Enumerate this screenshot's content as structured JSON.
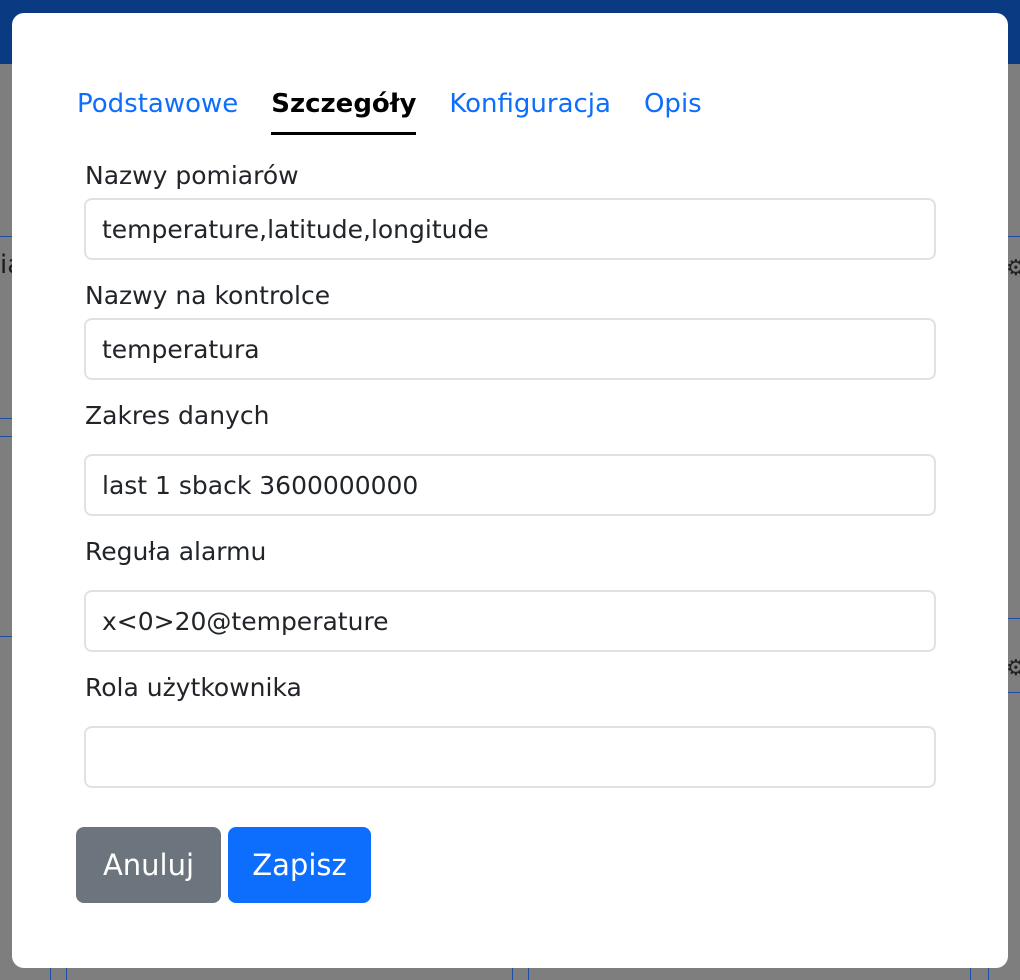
{
  "background": {
    "partial_text": "ia",
    "gear_icon": "gear-icon"
  },
  "modal": {
    "tabs": [
      {
        "label": "Podstawowe",
        "active": false
      },
      {
        "label": "Szczegóły",
        "active": true
      },
      {
        "label": "Konfiguracja",
        "active": false
      },
      {
        "label": "Opis",
        "active": false
      }
    ],
    "fields": [
      {
        "label": "Nazwy pomiarów",
        "value": "temperature,latitude,longitude"
      },
      {
        "label": "Nazwy na kontrolce",
        "value": "temperatura"
      },
      {
        "label": "Zakres danych",
        "value": "last 1 sback 3600000000"
      },
      {
        "label": "Reguła alarmu",
        "value": "x<0>20@temperature"
      },
      {
        "label": "Rola użytkownika",
        "value": ""
      }
    ],
    "buttons": {
      "cancel_label": "Anuluj",
      "save_label": "Zapisz"
    }
  },
  "colors": {
    "primary": "#0d6efd",
    "secondary": "#6c757d",
    "topbar": "#0a3a82"
  }
}
